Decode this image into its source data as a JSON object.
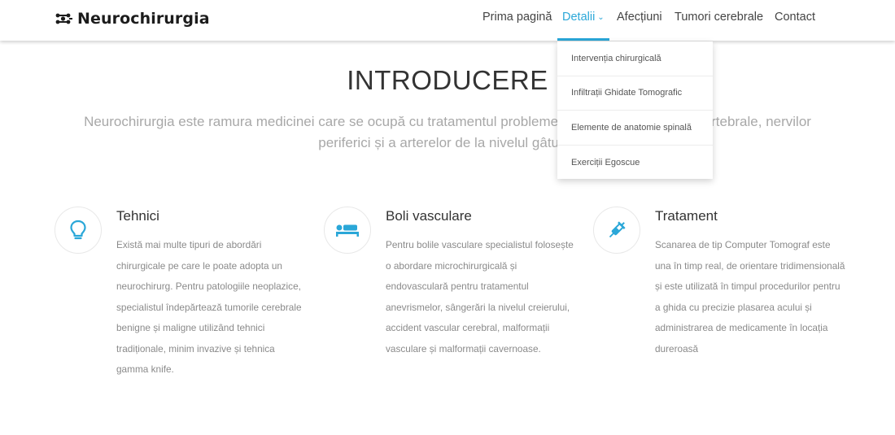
{
  "brand": {
    "name": "Neurochirurgia",
    "accent": "#2aa7d8"
  },
  "nav": {
    "items": [
      {
        "label": "Prima pagină"
      },
      {
        "label": "Detalii"
      },
      {
        "label": "Afecțiuni"
      },
      {
        "label": "Tumori cerebrale"
      },
      {
        "label": "Contact"
      }
    ],
    "active": "Detalii"
  },
  "dropdown": {
    "items": [
      {
        "label": "Intervenția chirurgicală"
      },
      {
        "label": "Infiltrații Ghidate Tomografic"
      },
      {
        "label": "Elemente de anatomie spinală"
      },
      {
        "label": "Exerciții Egoscue"
      }
    ]
  },
  "intro": {
    "title": "INTRODUCERE",
    "text": "Neurochirurgia este ramura medicinei care se ocupă cu tratamentul problemelor creierului, coloanei vertebrale, nervilor periferici și a arterelor de la nivelul gâtului."
  },
  "features": [
    {
      "icon": "lightbulb-icon",
      "title": "Tehnici",
      "text": "Există mai multe tipuri de abordări chirurgicale pe care le poate adopta un neurochirurg. Pentru patologiile neoplazice, specialistul îndepărtează tumorile cerebrale benigne și maligne utilizând tehnici tradiționale, minim invazive și tehnica gamma knife."
    },
    {
      "icon": "hospital-bed-icon",
      "title": "Boli vasculare",
      "text": "Pentru bolile vasculare specialistul folosește o abordare microchirurgicală și endovasculară pentru tratamentul anevrismelor, sângerări la nivelul creierului, accident vascular cerebral, malformații vasculare și malformații cavernoase."
    },
    {
      "icon": "syringe-icon",
      "title": "Tratament",
      "text": "Scanarea de tip Computer Tomograf este una în timp real, de orientare tridimensională și este utilizată în timpul procedurilor pentru a ghida cu precizie plasarea acului și administrarea de medicamente în locația dureroasă"
    }
  ]
}
